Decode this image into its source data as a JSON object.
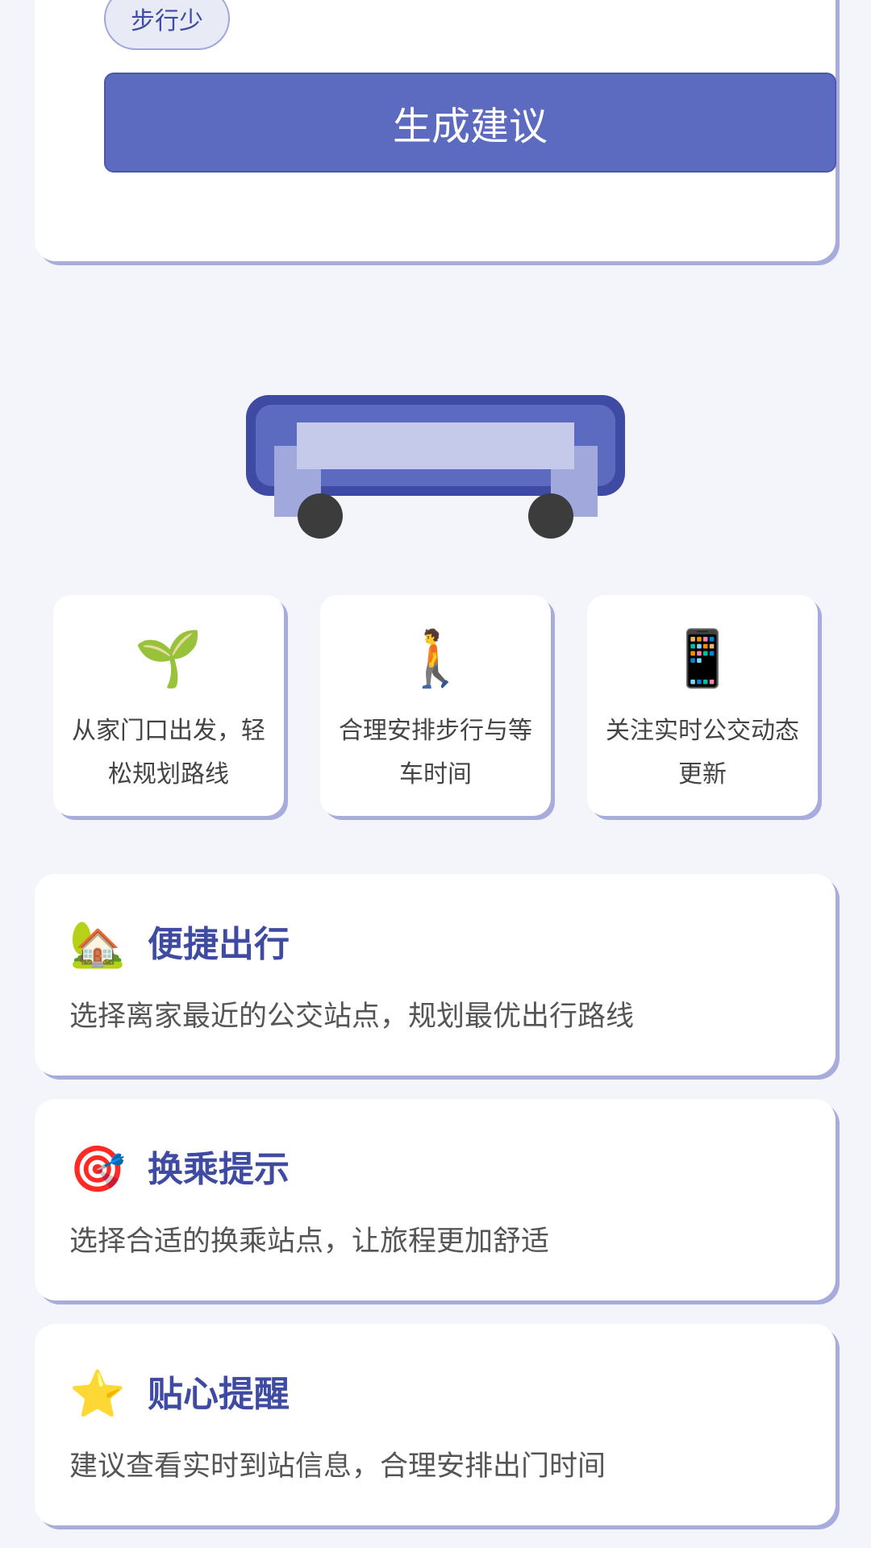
{
  "preferences": {
    "selected_chip": "步行少",
    "generate_button": "生成建议"
  },
  "features": [
    {
      "icon": "🌱",
      "icon_name": "seedling-icon",
      "text": "从家门口出发，轻松规划路线"
    },
    {
      "icon": "🚶",
      "icon_name": "walking-person-icon",
      "text": "合理安排步行与等车时间"
    },
    {
      "icon": "📱",
      "icon_name": "mobile-phone-icon",
      "text": "关注实时公交动态更新"
    }
  ],
  "tips": [
    {
      "icon": "🏡",
      "icon_name": "house-icon",
      "title": "便捷出行",
      "desc": "选择离家最近的公交站点，规划最优出行路线"
    },
    {
      "icon": "🎯",
      "icon_name": "target-icon",
      "title": "换乘提示",
      "desc": "选择合适的换乘站点，让旅程更加舒适"
    },
    {
      "icon": "⭐",
      "icon_name": "star-icon",
      "title": "贴心提醒",
      "desc": "建议查看实时到站信息，合理安排出门时间"
    }
  ],
  "colors": {
    "primary": "#5c6bc0",
    "primary_dark": "#3f4ba3",
    "shadow": "#a8acdc",
    "background": "#f4f5fa"
  }
}
